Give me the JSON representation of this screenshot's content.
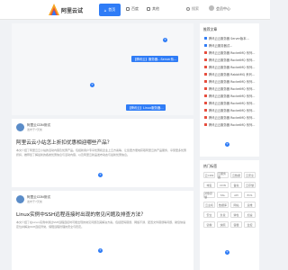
{
  "header": {
    "site_name": "阿里云试",
    "nav": [
      {
        "label": "首页"
      },
      {
        "label": "百度"
      },
      {
        "label": "其他"
      }
    ],
    "search_label": "搜索",
    "login_label": "会员中心"
  },
  "slider": {
    "captions": [
      "【腾讯云】服务器…Server系…",
      "【腾讯云】Linux服务器…"
    ],
    "plus_symbol": "+"
  },
  "posts": [
    {
      "author": "阿里云CDN测试",
      "date": "发布于7天前",
      "title": "阿里云云小站怎上折扣优惠相迎哪些产品？",
      "excerpt": "本文介绍了阿里云云小站的活动内容及优惠产品。包括新用户专享优惠和企业上云方案等，让您更方便地获取阿里云的产品服务，享受更多优惠折扣，推荐您了解最新的各类优惠信息与活动内容，以及阿里云新品发布动态与最新优惠信息。"
    },
    {
      "author": "阿里云CDN测试",
      "date": "发布于7天前",
      "title": "Linux实例中SSH远程连接时出现的常见问题及排查方法？",
      "excerpt": "本文介绍了在Linux实例中通过SSH远程连接时可能出现的常见问题及其解决方案。包括密码错误、网络不通、配置文件错误等问题，助您快速定位并解决SSH连接异常，保障远程管理的安全与稳定。"
    }
  ],
  "sidebar": {
    "recommend_title": "推荐文章",
    "recommend_items": [
      {
        "label": "腾讯云云服务器 Server版本..."
      },
      {
        "label": "腾讯云服务器试..."
      },
      {
        "label": "腾讯云云服务器 RocketMQ 系列..."
      },
      {
        "label": "腾讯云云服务器 RocketMQ 系列..."
      },
      {
        "label": "腾讯云云服务器 RocketMQ 系列..."
      },
      {
        "label": "腾讯云云服务器 RabbitMQ 系列..."
      },
      {
        "label": "腾讯云云服务器 RocketMQ 系列..."
      },
      {
        "label": "腾讯云云服务器 RocketMQ 系列..."
      },
      {
        "label": "腾讯云云服务器 RocketMQ 系列..."
      },
      {
        "label": "腾讯云云服务器 RocketMQ 系列..."
      },
      {
        "label": "腾讯云云服务器 RocketMQ 系列..."
      },
      {
        "label": "腾讯云云服务器 RocketMQ 系列..."
      },
      {
        "label": "腾讯云云服务器 RocketMQ 系列..."
      }
    ],
    "tags_title": "热门标签",
    "tags": [
      "云CDN",
      "云服务器",
      "云数据",
      "云安全",
      "域名",
      "CDN",
      "备案",
      "云存储",
      "对象存储",
      "SSL",
      "API",
      "ECS",
      "云主机",
      "数据库",
      "网站",
      "运维",
      "安全",
      "负载",
      "弹性",
      "加速",
      "镜像",
      "快照",
      "容器",
      "监控"
    ]
  },
  "colors": {
    "accent": "#2f7cf6",
    "hot": "#e74c3c"
  }
}
